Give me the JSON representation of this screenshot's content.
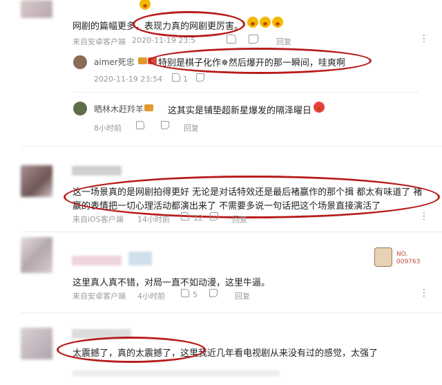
{
  "comments": [
    {
      "text": "网剧的篇幅更多，表现力真的网剧更厉害。",
      "meta": {
        "source": "来自安卓客户端",
        "time": "2020-11-19 23:5",
        "reply_label": "回复"
      },
      "replies": [
        {
          "name": "aimer死忠",
          "text": "特别是棋子化作✵然后爆开的那一瞬间，哇爽啊",
          "time": "2020-11-19 23:54",
          "like_count": "1",
          "reply_label": ""
        },
        {
          "name": "晒林木赶羚羊",
          "text": "这其实是铺垫超新星爆发的隔泽曜日",
          "time": "8小时前",
          "reply_label": "回复"
        }
      ]
    },
    {
      "text_line1": "这一场景真的是网剧拍得更好 无论是对话特效还是最后褚嬴作的那个揖 都太有味道了 褚",
      "text_line2": "嬴的表情把一切心理活动都演出来了 不需要多说一句话把这个场景直接演活了",
      "meta": {
        "source": "来自iOS客户端",
        "time": "14小时前",
        "like_count": "12",
        "reply_label": "回复"
      }
    },
    {
      "text": "这里真人真不错，对局一直不如动漫，这里牛逼。",
      "badge_text_1": "NO.",
      "badge_text_2": "009763",
      "meta": {
        "source": "来自安卓客户端",
        "time": "4小时前",
        "like_count": "5",
        "reply_label": "回复"
      }
    },
    {
      "text": "太震撼了，真的太震撼了，这里我近几年看电视剧从来没有过的感觉，太强了",
      "meta": {
        "source": "",
        "time": "",
        "reply_label": ""
      }
    }
  ]
}
